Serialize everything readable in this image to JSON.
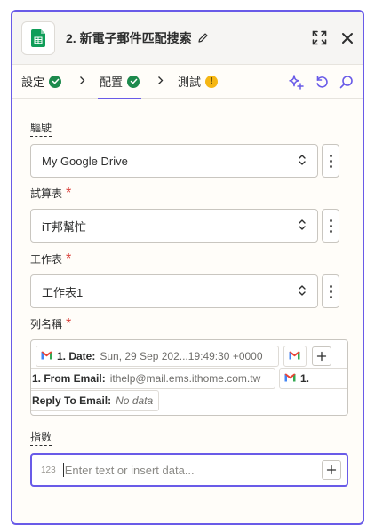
{
  "header": {
    "step_title": "2. 新電子郵件匹配搜索",
    "icons": [
      "google-sheets-icon",
      "pencil-icon",
      "expand-icon",
      "close-icon"
    ]
  },
  "tabs": [
    {
      "label": "設定",
      "status": "complete"
    },
    {
      "label": "配置",
      "status": "complete",
      "active": true
    },
    {
      "label": "測試",
      "status": "warning",
      "status_text": "!"
    }
  ],
  "tab_actions": [
    "sparkle-icon",
    "refresh-icon",
    "search-icon"
  ],
  "fields": {
    "drive": {
      "label": "驅駛",
      "value": "My Google Drive"
    },
    "spreadsheet": {
      "label": "試算表",
      "required_mark": "*",
      "value": "iT邦幫忙"
    },
    "worksheet": {
      "label": "工作表",
      "required_mark": "*",
      "value": "工作表1"
    },
    "column_name": {
      "label": "列名稱",
      "required_mark": "*",
      "pills": [
        {
          "key": "1. Date:",
          "value": "Sun, 29 Sep 202...19:49:30 +0000"
        },
        {
          "key": "1. From Email:",
          "value": "ithelp@mail.ems.ithome.com.tw"
        },
        {
          "key": "1.",
          "value": ""
        },
        {
          "key": "Reply To Email:",
          "value": "No data"
        }
      ]
    },
    "index": {
      "label": "指數",
      "type_hint": "123",
      "placeholder": "Enter text or insert data..."
    }
  },
  "colors": {
    "accent": "#695be8",
    "success": "#1d8a4d",
    "warning": "#f5b613",
    "required": "#d83a34",
    "sheets_green": "#0f9d58"
  }
}
